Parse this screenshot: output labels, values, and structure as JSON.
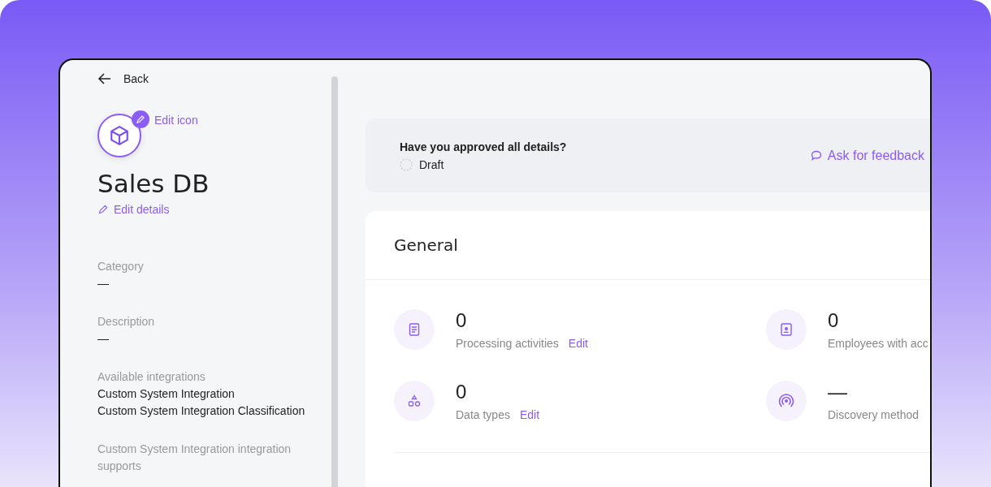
{
  "back": {
    "label": "Back"
  },
  "system": {
    "edit_icon": "Edit icon",
    "name": "Sales DB",
    "edit_details": "Edit details"
  },
  "fields": [
    {
      "label": "Category",
      "values": [
        "—"
      ]
    },
    {
      "label": "Description",
      "values": [
        "—"
      ]
    },
    {
      "label": "Available integrations",
      "values": [
        "Custom System Integration",
        "Custom System Integration Classification"
      ]
    },
    {
      "label": "Custom System Integration integration supports"
    }
  ],
  "approval": {
    "question": "Have you approved all details?",
    "status": "Draft",
    "feedback": "Ask for feedback"
  },
  "general": {
    "title": "General",
    "stats": [
      {
        "kind": "document",
        "value": "0",
        "label": "Processing activities",
        "edit": "Edit"
      },
      {
        "kind": "badge",
        "value": "0",
        "label": "Employees with acc"
      },
      {
        "kind": "shapes",
        "value": "0",
        "label": "Data types",
        "edit": "Edit"
      },
      {
        "kind": "signal",
        "value": "—",
        "label": "Discovery method"
      }
    ]
  }
}
